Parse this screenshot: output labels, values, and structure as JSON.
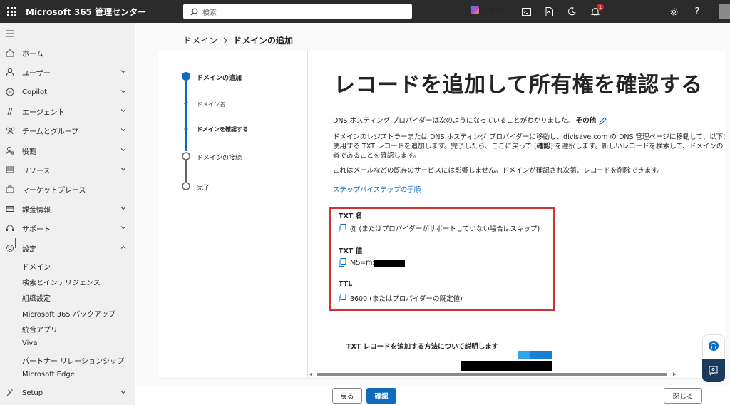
{
  "topbar": {
    "app_name": "Microsoft 365 管理センター",
    "search_placeholder": "検索",
    "copilot_label": "Copilot",
    "notification_count": "1"
  },
  "sidebar": {
    "items": [
      {
        "label": "ホーム",
        "icon": "home-icon"
      },
      {
        "label": "ユーザー",
        "icon": "user-icon"
      },
      {
        "label": "Copilot",
        "icon": "copilot-icon"
      },
      {
        "label": "エージェント",
        "icon": "agent-icon"
      },
      {
        "label": "チームとグループ",
        "icon": "teams-icon"
      },
      {
        "label": "役割",
        "icon": "role-icon"
      },
      {
        "label": "リソース",
        "icon": "resource-icon"
      },
      {
        "label": "マーケットプレース",
        "icon": "marketplace-icon"
      },
      {
        "label": "課金情報",
        "icon": "billing-icon"
      },
      {
        "label": "サポート",
        "icon": "support-icon"
      },
      {
        "label": "設定",
        "icon": "settings-icon"
      }
    ],
    "subitems": [
      "ドメイン",
      "検索とインテリジェンス",
      "組織設定",
      "Microsoft 365 バックアップ",
      "統合アプリ",
      "Viva",
      "パートナー リレーションシップ",
      "Microsoft Edge"
    ],
    "setup_label": "Setup"
  },
  "breadcrumb": {
    "parent": "ドメイン",
    "current": "ドメインの追加"
  },
  "stepper": {
    "steps": [
      {
        "label": "ドメインの追加"
      },
      {
        "label": "ドメイン名"
      },
      {
        "label": "ドメインを確認する"
      },
      {
        "label": "ドメインの接続"
      },
      {
        "label": "完了"
      }
    ]
  },
  "content": {
    "title": "レコードを追加して所有権を確認する",
    "intro_prefix": "DNS ホスティング プロバイダーは次のようになっていることがわかりました。",
    "intro_other": "その他",
    "para1_line1": "ドメインのレジストラーまたは DNS ホスティング プロバイダーに移動し、divisave.com の DNS 管理ページに移動して、以下の",
    "para1_line2_a": "使用する TXT レコードを追加します。完了したら、ここに戻って [",
    "para1_line2_b": "確認",
    "para1_line2_c": "] を選択します。新しいレコードを検索して、ドメインの",
    "para1_line3": "者であることを確認します。",
    "para2": "これはメールなどの既存のサービスには影響しません。ドメインが確認され次第、レコードを削除できます。",
    "step_link": "ステップバイステップの手順",
    "txt_name_label": "TXT 名",
    "txt_name_value": "@ (またはプロバイダーがサポートしていない場合はスキップ)",
    "txt_value_label": "TXT 値",
    "txt_value_value": "MS=ms",
    "ttl_label": "TTL",
    "ttl_value": "3600 (またはプロバイダーの既定値)",
    "video_title": "TXT レコードを追加する方法について説明します"
  },
  "footer": {
    "back": "戻る",
    "verify": "確認",
    "close": "閉じる"
  },
  "colors": {
    "accent": "#0f6cbd",
    "highlight": "#d13438",
    "topbar": "#2b2b2b"
  }
}
